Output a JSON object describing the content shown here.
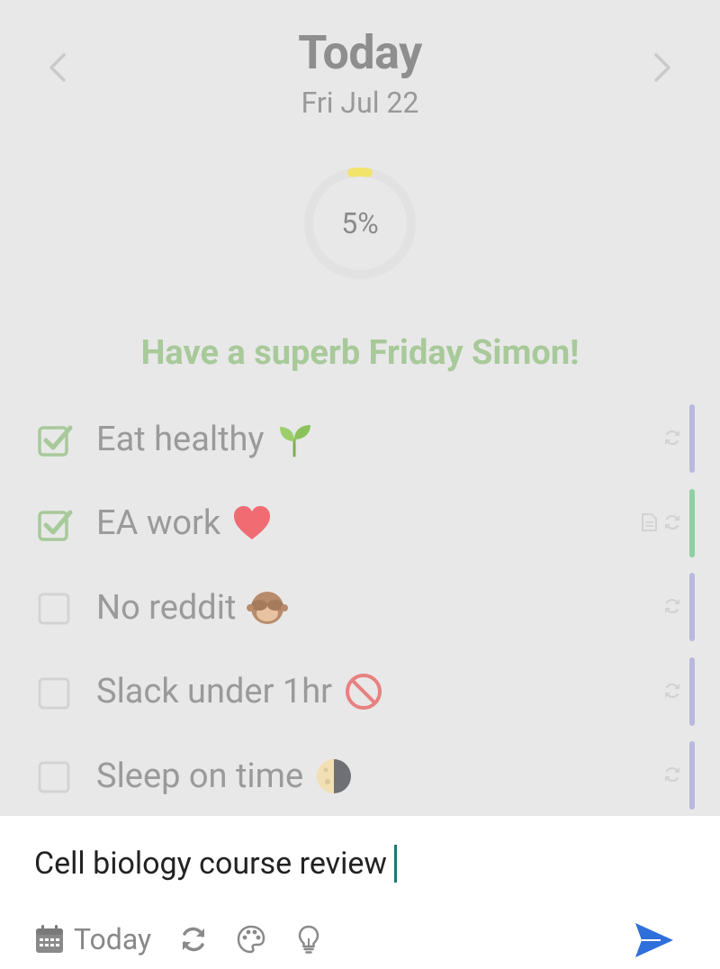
{
  "header": {
    "title": "Today",
    "date": "Fri Jul 22",
    "prev_icon": "chevron-left-icon",
    "next_icon": "chevron-right-icon"
  },
  "progress": {
    "label": "5%",
    "value": 0.05,
    "color": "#f2e36b"
  },
  "greeting": "Have a superb Friday Simon!",
  "tasks": [
    {
      "label": "Eat healthy",
      "emoji": "seedling",
      "checked": true,
      "icons": [
        "repeat-icon"
      ],
      "bar_color": "#b9b8de"
    },
    {
      "label": "EA work",
      "emoji": "heart",
      "checked": true,
      "icons": [
        "note-icon",
        "repeat-icon"
      ],
      "bar_color": "#8fd0a3"
    },
    {
      "label": "No reddit",
      "emoji": "see-no-evil-monkey",
      "checked": false,
      "icons": [
        "repeat-icon"
      ],
      "bar_color": "#b9b8de"
    },
    {
      "label": "Slack under 1hr",
      "emoji": "prohibited",
      "checked": false,
      "icons": [
        "repeat-icon"
      ],
      "bar_color": "#b9b8de"
    },
    {
      "label": "Sleep on time",
      "emoji": "moon",
      "checked": false,
      "icons": [
        "repeat-icon"
      ],
      "bar_color": "#b9b8de"
    }
  ],
  "composer": {
    "value": "Cell biology course review",
    "toolbar": {
      "date_label": "Today",
      "date_icon": "calendar-icon",
      "repeat_icon": "repeat-icon",
      "color_icon": "palette-icon",
      "idea_icon": "lightbulb-icon",
      "send_icon": "send-icon"
    },
    "send_color": "#2f6fdb"
  }
}
